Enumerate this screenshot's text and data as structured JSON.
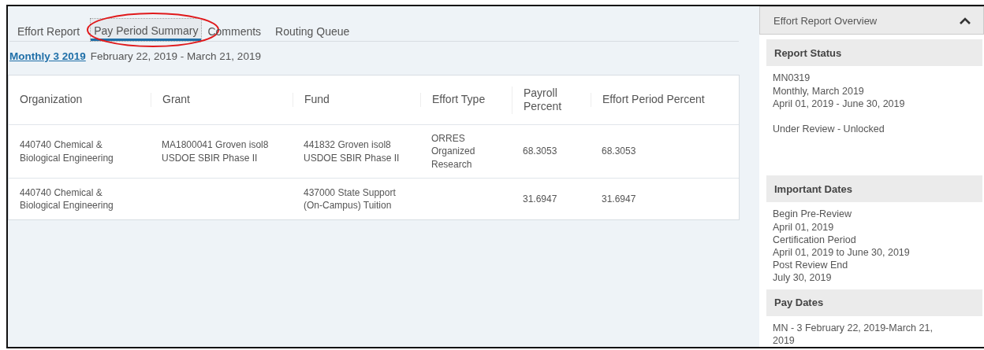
{
  "tabs": [
    {
      "label": "Effort Report",
      "selected": false,
      "circled": false
    },
    {
      "label": "Pay Period Summary",
      "selected": true,
      "circled": true
    },
    {
      "label": "Comments",
      "selected": false,
      "circled": false
    },
    {
      "label": "Routing Queue",
      "selected": false,
      "circled": false
    }
  ],
  "period": {
    "link": "Monthly 3 2019",
    "range": "February 22, 2019 - March 21, 2019"
  },
  "table": {
    "columns": [
      "Organization",
      "Grant",
      "Fund",
      "Effort Type",
      "Payroll Percent",
      "Effort Period Percent"
    ],
    "rows": [
      [
        "440740 Chemical & Biological Engineering",
        "MA1800041 Groven isol8 USDOE SBIR Phase II",
        "441832 Groven isol8 USDOE SBIR Phase II",
        "ORRES Organized Research",
        "68.3053",
        "68.3053"
      ],
      [
        "440740 Chemical & Biological Engineering",
        "",
        "437000 State Support (On-Campus) Tuition",
        "",
        "31.6947",
        "31.6947"
      ]
    ]
  },
  "sidebar": {
    "title": "Effort Report Overview",
    "expanded": true,
    "sections": [
      {
        "title": "Report Status",
        "groups": [
          [
            "MN0319",
            "Monthly, March 2019",
            "April 01, 2019 - June 30, 2019"
          ],
          [
            "Under Review - Unlocked"
          ]
        ]
      },
      {
        "title": "Important Dates",
        "groups": [
          [
            "Begin Pre-Review",
            "April 01, 2019",
            "Certification Period",
            "April 01, 2019 to June 30, 2019",
            "Post Review End",
            "July 30, 2019"
          ]
        ]
      },
      {
        "title": "Pay Dates",
        "groups": [
          [
            "MN - 3 February 22, 2019-March 21, 2019"
          ]
        ]
      }
    ]
  }
}
